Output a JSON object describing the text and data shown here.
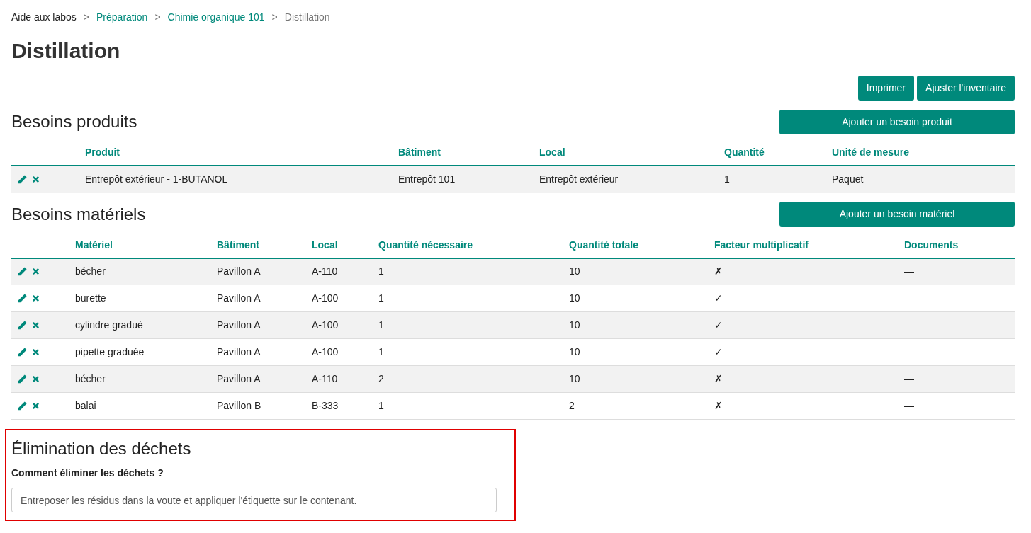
{
  "breadcrumb": [
    {
      "label": "Aide aux labos",
      "kind": "root"
    },
    {
      "label": "Préparation",
      "kind": "link"
    },
    {
      "label": "Chimie organique 101",
      "kind": "link"
    },
    {
      "label": "Distillation",
      "kind": "current"
    }
  ],
  "breadcrumb_separator": ">",
  "title": "Distillation",
  "actions": [
    "Imprimer",
    "Ajuster l'inventaire"
  ],
  "products": {
    "heading": "Besoins produits",
    "add_button": "Ajouter un besoin produit",
    "columns": [
      "Produit",
      "Bâtiment",
      "Local",
      "Quantité",
      "Unité de mesure"
    ],
    "rows": [
      {
        "cells": [
          "Entrepôt extérieur - 1-BUTANOL",
          "Entrepôt 101",
          "Entrepôt extérieur",
          "1",
          "Paquet"
        ]
      }
    ]
  },
  "materials": {
    "heading": "Besoins matériels",
    "add_button": "Ajouter un besoin matériel",
    "columns": [
      "Matériel",
      "Bâtiment",
      "Local",
      "Quantité nécessaire",
      "Quantité totale",
      "Facteur multiplicatif",
      "Documents"
    ],
    "rows": [
      {
        "cells": [
          "bécher",
          "Pavillon A",
          "A-110",
          "1",
          "10",
          "✗",
          "—"
        ]
      },
      {
        "cells": [
          "burette",
          "Pavillon A",
          "A-100",
          "1",
          "10",
          "✓",
          "—"
        ]
      },
      {
        "cells": [
          "cylindre gradué",
          "Pavillon A",
          "A-100",
          "1",
          "10",
          "✓",
          "—"
        ]
      },
      {
        "cells": [
          "pipette graduée",
          "Pavillon A",
          "A-100",
          "1",
          "10",
          "✓",
          "—"
        ]
      },
      {
        "cells": [
          "bécher",
          "Pavillon A",
          "A-110",
          "2",
          "10",
          "✗",
          "—"
        ]
      },
      {
        "cells": [
          "balai",
          "Pavillon B",
          "B-333",
          "1",
          "2",
          "✗",
          "—"
        ]
      }
    ]
  },
  "waste": {
    "heading": "Élimination des déchets",
    "label": "Comment éliminer les déchets ?",
    "value": "Entreposer les résidus dans la voute et appliquer l'étiquette sur le contenant.",
    "highlighted": true
  }
}
